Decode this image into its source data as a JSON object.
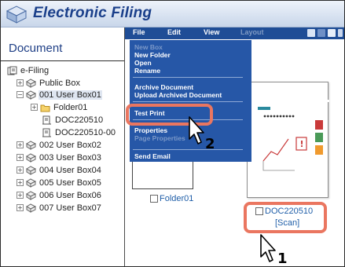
{
  "app": {
    "title": "Electronic Filing"
  },
  "left_pane": {
    "heading": "Document",
    "tree": [
      {
        "label": "e-Filing",
        "expander": "",
        "icon": "efiling-root-icon"
      },
      {
        "label": "Public Box",
        "expander": "+",
        "icon": "box-icon"
      },
      {
        "label": "001 User Box01",
        "expander": "−",
        "icon": "box-open-icon",
        "selected": true
      },
      {
        "label": "Folder01",
        "expander": "+",
        "icon": "folder-icon"
      },
      {
        "label": "DOC220510",
        "expander": "",
        "icon": "document-icon"
      },
      {
        "label": "DOC220510-00",
        "expander": "",
        "icon": "document-icon"
      },
      {
        "label": "002 User Box02",
        "expander": "+",
        "icon": "box-icon"
      },
      {
        "label": "003 User Box03",
        "expander": "+",
        "icon": "box-icon"
      },
      {
        "label": "004 User Box04",
        "expander": "+",
        "icon": "box-icon"
      },
      {
        "label": "005 User Box05",
        "expander": "+",
        "icon": "box-icon"
      },
      {
        "label": "006 User Box06",
        "expander": "+",
        "icon": "box-icon"
      },
      {
        "label": "007 User Box07",
        "expander": "+",
        "icon": "box-icon"
      }
    ]
  },
  "menubar": {
    "items": [
      {
        "label": "File",
        "enabled": true
      },
      {
        "label": "Edit",
        "enabled": true
      },
      {
        "label": "View",
        "enabled": true
      },
      {
        "label": "Layout",
        "enabled": false
      }
    ]
  },
  "file_menu": {
    "items": [
      {
        "label": "New Box",
        "enabled": false
      },
      {
        "label": "New Folder",
        "enabled": true
      },
      {
        "label": "Open",
        "enabled": true
      },
      {
        "label": "Rename",
        "enabled": true
      },
      {
        "label": "Archive Document",
        "enabled": true
      },
      {
        "label": "Upload Archived Document",
        "enabled": true
      },
      {
        "label": "Test Print",
        "enabled": true,
        "highlighted": true
      },
      {
        "label": "Properties",
        "enabled": true
      },
      {
        "label": "Page Properties",
        "enabled": false
      },
      {
        "label": "Send Email",
        "enabled": true
      }
    ]
  },
  "content": {
    "folder": {
      "label": "Folder01"
    },
    "document": {
      "label": "DOC220510",
      "tag": "[Scan]",
      "selected": true
    }
  },
  "annotations": {
    "step1": "1",
    "step2": "2",
    "highlight_color": "#ea7660"
  },
  "colors": {
    "menubar": "#1f4d96",
    "menu_bg": "#2657a7",
    "title_text": "#1a3f8a"
  }
}
